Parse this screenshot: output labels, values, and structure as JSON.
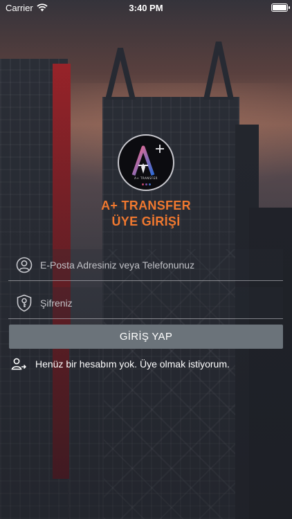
{
  "status_bar": {
    "carrier": "Carrier",
    "time": "3:40 PM",
    "battery_level": 1.0
  },
  "logo": {
    "letters": "A+",
    "brand_text": "A+ TRANSFER",
    "dot_colors": [
      "#c2466a",
      "#7b4fa8",
      "#3f6fc3"
    ]
  },
  "title": {
    "line1": "A+ TRANSFER",
    "line2": "ÜYE GİRİŞİ"
  },
  "form": {
    "email_placeholder": "E-Posta Adresiniz veya Telefonunuz",
    "email_value": "",
    "password_placeholder": "Şifreniz",
    "password_value": "",
    "login_label": "GİRİŞ YAP"
  },
  "signup": {
    "label": "Henüz bir hesabım yok. Üye olmak istiyorum."
  },
  "colors": {
    "accent": "#f0782f",
    "button": "#6b737a"
  },
  "icons": [
    "wifi-icon",
    "battery-icon",
    "user-icon",
    "key-shield-icon",
    "user-add-icon"
  ]
}
